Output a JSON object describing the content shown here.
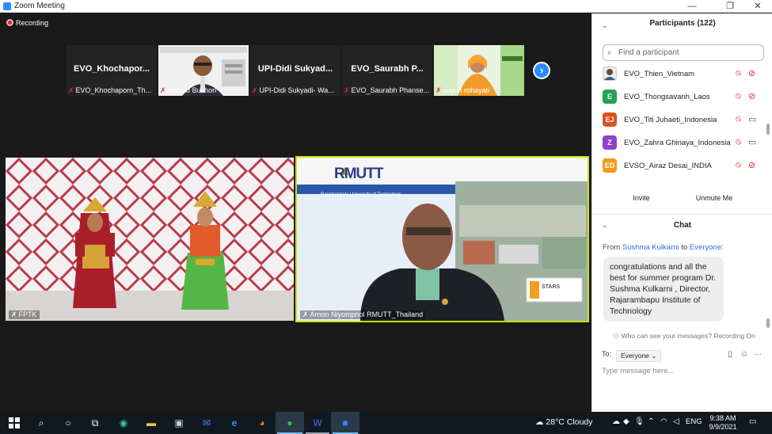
{
  "window": {
    "title": "Zoom Meeting",
    "controls": [
      "—",
      "❐",
      "✕"
    ]
  },
  "recording": {
    "label": "Recording"
  },
  "thumbnails": [
    {
      "name": "EVO_Khochapor...",
      "label": "EVO_Khochaporn_Th...",
      "type": "name"
    },
    {
      "name": "",
      "label": "Ahmad Bukhori",
      "type": "video"
    },
    {
      "name": "UPI-Didi  Sukyad...",
      "label": "UPI-Didi Sukyadi- Wa...",
      "type": "name"
    },
    {
      "name": "EVO_Saurabh  P...",
      "label": "EVO_Saurabh Phanse...",
      "type": "name"
    },
    {
      "name": "",
      "label": "yuyun rohayati",
      "type": "video"
    }
  ],
  "main_tiles": [
    {
      "label": "FPTK"
    },
    {
      "label": "Arnon Niyomphol   RMUTT_Thailand",
      "slide_brand": "RMUTT",
      "slide_sub": "Rajamangala University of Technology",
      "stars_badge": "STARS"
    }
  ],
  "participants": {
    "title": "Participants (122)",
    "search_placeholder": "Find a participant",
    "list": [
      {
        "name": "EVO_Thien_Vietnam",
        "initials": "",
        "color": "#e8f0ee",
        "cam": "off"
      },
      {
        "name": "EVO_Thongsavanh_Laos",
        "initials": "E",
        "color": "#23a455",
        "cam": "off"
      },
      {
        "name": "EVO_Titi Juhaeti_Indonesia",
        "initials": "EJ",
        "color": "#d9531e",
        "cam": "on"
      },
      {
        "name": "EVO_Zahra Ghinaya_Indonesia",
        "initials": "Z",
        "color": "#8e44c9",
        "cam": "on"
      },
      {
        "name": "EVSO_Airaz Desai_INDIA",
        "initials": "ED",
        "color": "#f39c12",
        "cam": "off"
      }
    ],
    "invite_label": "Invite",
    "unmute_label": "Unmute Me"
  },
  "chat": {
    "title": "Chat",
    "from_prefix": "From",
    "from_name": "Sushma Kulkarni",
    "to_word": "to",
    "to_target": "Everyone",
    "message": "congratulations and all the best for summer program Dr. Sushma Kulkarni , Director, Rajarambapu Institute of Technology",
    "visibility_note": "Who can see your messages? Recording On",
    "to_label": "To:",
    "to_select": "Everyone",
    "input_placeholder": "Type message here..."
  },
  "taskbar": {
    "weather_temp": "28°C",
    "weather_desc": "Cloudy",
    "language": "ENG",
    "time": "9:38 AM",
    "date": "9/9/2021"
  }
}
